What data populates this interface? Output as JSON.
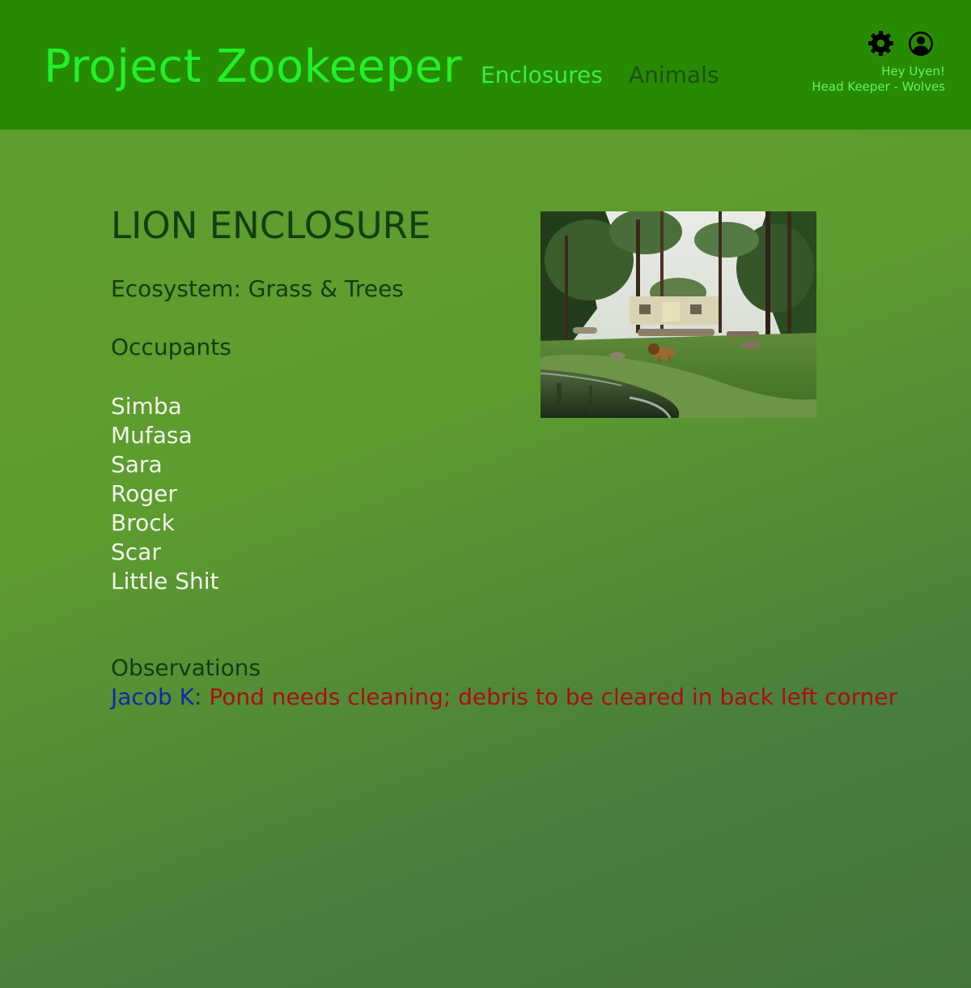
{
  "header": {
    "app_title": "Project Zookeeper",
    "nav": [
      {
        "label": "Enclosures"
      },
      {
        "label": "Animals"
      }
    ],
    "settings_icon": "gear-icon",
    "profile_icon": "user-avatar-icon",
    "greeting": "Hey Uyen!",
    "role": "Head Keeper - Wolves"
  },
  "enclosure": {
    "title": "LION ENCLOSURE",
    "ecosystem": "Ecosystem: Grass & Trees",
    "occupants_heading": "Occupants",
    "occupants": [
      "Simba",
      "Mufasa",
      "Sara",
      "Roger",
      "Brock",
      "Scar",
      "Little Shit"
    ],
    "observations_heading": "Observations",
    "observations": [
      {
        "author": "Jacob K",
        "separator": ":",
        "text": " Pond needs cleaning; debris to be cleared in back left corner"
      }
    ]
  },
  "colors": {
    "header_bg": "#268b00",
    "title": "#22f028",
    "nav_active": "#38ed55",
    "nav_inactive": "#1f4d1a",
    "observation_author": "#0b2ca6",
    "observation_text": "#a80f14"
  }
}
